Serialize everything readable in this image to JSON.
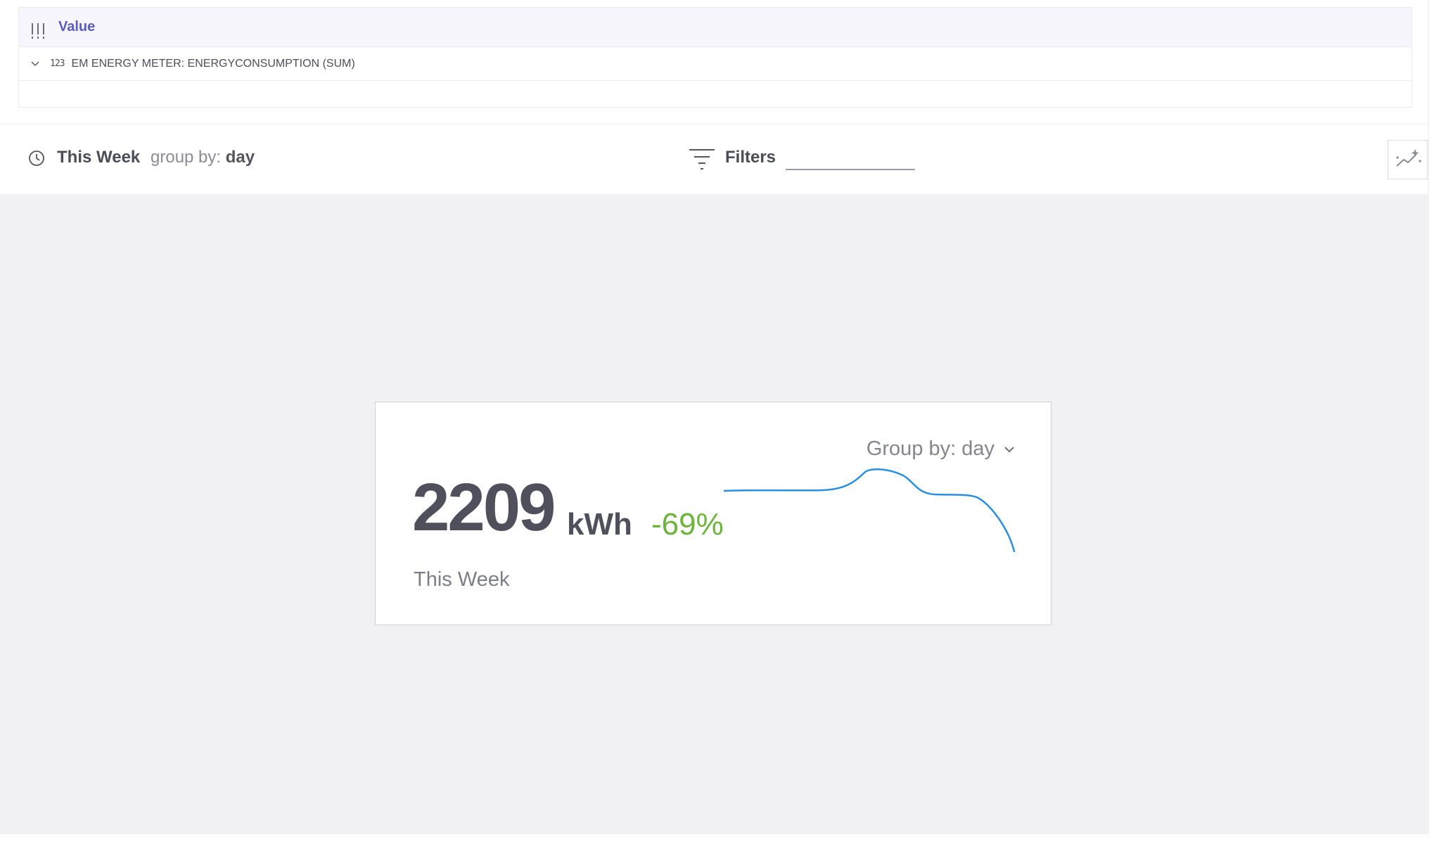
{
  "value_panel": {
    "title": "Value",
    "measure": {
      "icon_text": "123",
      "label": "EM ENERGY METER: ENERGYCONSUMPTION (SUM)"
    }
  },
  "toolbar": {
    "time_range": "This Week",
    "group_by_label": "group by:",
    "group_by_value": "day",
    "filters_label": "Filters",
    "filters_value": ""
  },
  "kpi_card": {
    "group_by": "Group by: day",
    "value": "2209",
    "unit": "kWh",
    "delta": "-69%",
    "period": "This Week",
    "sparkline_color": "#2b8fe0",
    "delta_color": "#6cb43c"
  },
  "accent_color": "#5a5cc4"
}
